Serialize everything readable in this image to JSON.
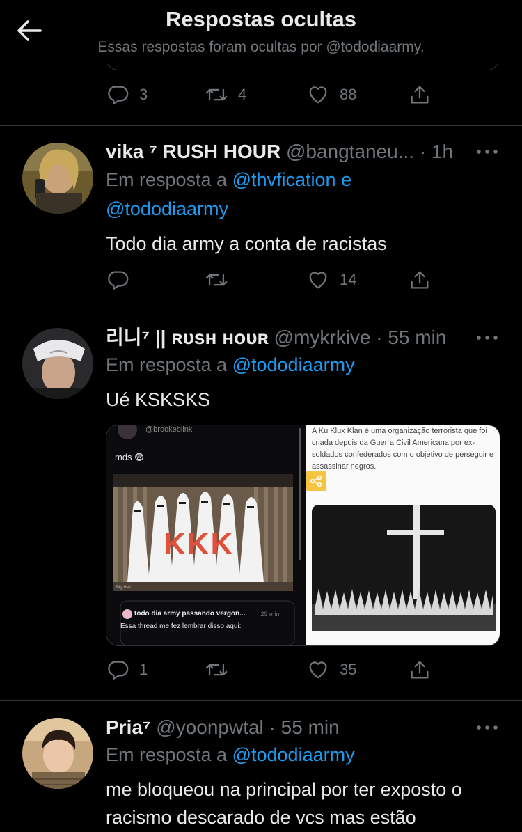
{
  "header": {
    "title": "Respostas ocultas",
    "subtitle": "Essas respostas foram ocultas por @tododiaarmy."
  },
  "prev_tweet": {
    "replies": "3",
    "retweets": "4",
    "likes": "88"
  },
  "tweets": [
    {
      "name": "vika ⁷ RUSH HOUR",
      "handle": "@bangtaneu...",
      "time": "· 1h",
      "reply_prefix": "Em resposta a",
      "reply_to_1": "@thvfication e",
      "reply_to_2": "@tododiaarmy",
      "text": "Todo dia army a conta de racistas",
      "replies": "",
      "retweets": "",
      "likes": "14"
    },
    {
      "name": "리니⁷ || ʀᴜsʜ ʜᴏᴜʀ",
      "handle": "@mykrkive",
      "time": "· 55 min",
      "reply_prefix": "Em resposta a",
      "reply_to_1": "@tododiaarmy",
      "text": "Ué KSKSKS",
      "replies": "1",
      "retweets": "",
      "likes": "35",
      "media": {
        "left_handle": "@brookeblink",
        "left_caption": "mds 😨",
        "left_overlay": "KKK",
        "left_tag": "Big Hall",
        "quote_author": "todo dia army passando vergon...",
        "quote_time": "· 29 min",
        "quote_text": "Essa thread me fez lembrar disso aqui:",
        "right_text": "A Ku Klux Klan é uma organização terrorista que foi criada depois da Guerra Civil Americana por ex-soldados confederados com o objetivo de perseguir e assassinar negros."
      }
    },
    {
      "name": "Pria⁷",
      "handle": "@yoonpwtal",
      "time": "· 55 min",
      "reply_prefix": "Em resposta a",
      "reply_to_1": "@tododiaarmy",
      "text": "me bloqueou na principal por ter exposto o racismo descarado de vcs mas estão"
    }
  ]
}
